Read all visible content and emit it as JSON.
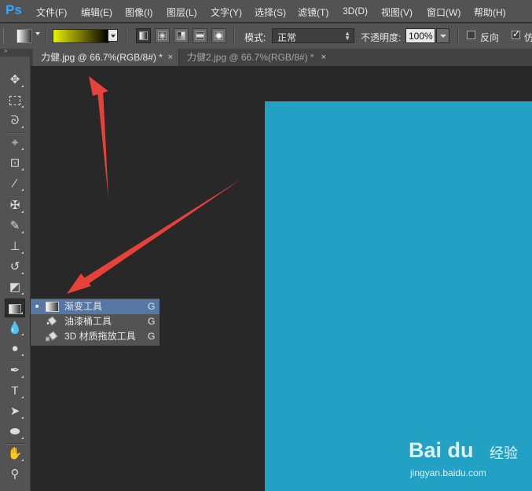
{
  "app": {
    "logo": "Ps"
  },
  "menu": [
    {
      "label": "文件(F)"
    },
    {
      "label": "编辑(E)"
    },
    {
      "label": "图像(I)"
    },
    {
      "label": "图层(L)"
    },
    {
      "label": "文字(Y)"
    },
    {
      "label": "选择(S)"
    },
    {
      "label": "滤镜(T)"
    },
    {
      "label": "3D(D)"
    },
    {
      "label": "视图(V)"
    },
    {
      "label": "窗口(W)"
    },
    {
      "label": "帮助(H)"
    }
  ],
  "options": {
    "mode_label": "模式:",
    "mode_value": "正常",
    "opacity_label": "不透明度:",
    "opacity_value": "100%",
    "reverse_label": "反向",
    "reverse_checked": false,
    "dither_label": "仿",
    "dither_checked": true,
    "gradient_colors": [
      "#e7f000",
      "#000000"
    ]
  },
  "tabs": [
    {
      "label": "力健.jpg @ 66.7%(RGB/8#) *",
      "close": "×",
      "active": true
    },
    {
      "label": "力健2.jpg @ 66.7%(RGB/8#) *",
      "close": "×",
      "active": false
    }
  ],
  "toolbar": {
    "grip": "»",
    "tools": [
      {
        "name": "move-tool",
        "glyph": "▸✢"
      },
      {
        "name": "marquee-tool",
        "glyph": "⬚"
      },
      {
        "name": "lasso-tool",
        "glyph": "ᘏ"
      },
      {
        "name": "quick-select-tool",
        "glyph": "✎"
      },
      {
        "name": "crop-tool",
        "glyph": "⌗"
      },
      {
        "name": "eyedropper-tool",
        "glyph": "⁄"
      },
      {
        "name": "healing-brush-tool",
        "glyph": "✚"
      },
      {
        "name": "brush-tool",
        "glyph": "✎"
      },
      {
        "name": "clone-stamp-tool",
        "glyph": "⊥"
      },
      {
        "name": "history-brush-tool",
        "glyph": "↺"
      },
      {
        "name": "eraser-tool",
        "glyph": "⌫"
      },
      {
        "name": "gradient-tool",
        "glyph": "▭"
      },
      {
        "name": "blur-tool",
        "glyph": "●"
      },
      {
        "name": "dodge-tool",
        "glyph": "◔"
      },
      {
        "name": "pen-tool",
        "glyph": "✒"
      },
      {
        "name": "type-tool",
        "glyph": "T"
      },
      {
        "name": "path-select-tool",
        "glyph": "➤"
      },
      {
        "name": "ellipse-tool",
        "glyph": "⬭"
      },
      {
        "name": "hand-tool",
        "glyph": "✋"
      },
      {
        "name": "zoom-tool",
        "glyph": "⌕"
      }
    ]
  },
  "flyout": [
    {
      "label": "渐变工具",
      "key": "G",
      "selected": true,
      "bullet": "■"
    },
    {
      "label": "油漆桶工具",
      "key": "G",
      "selected": false,
      "bullet": ""
    },
    {
      "label": "3D 材质拖放工具",
      "key": "G",
      "selected": false,
      "bullet": ""
    }
  ],
  "canvas": {
    "color": "#22a1c4"
  },
  "annotation": {
    "arrow_color": "#e8413a"
  },
  "watermark": {
    "brand": "Bai du",
    "product": "经验",
    "url": "jingyan.baidu.com"
  }
}
